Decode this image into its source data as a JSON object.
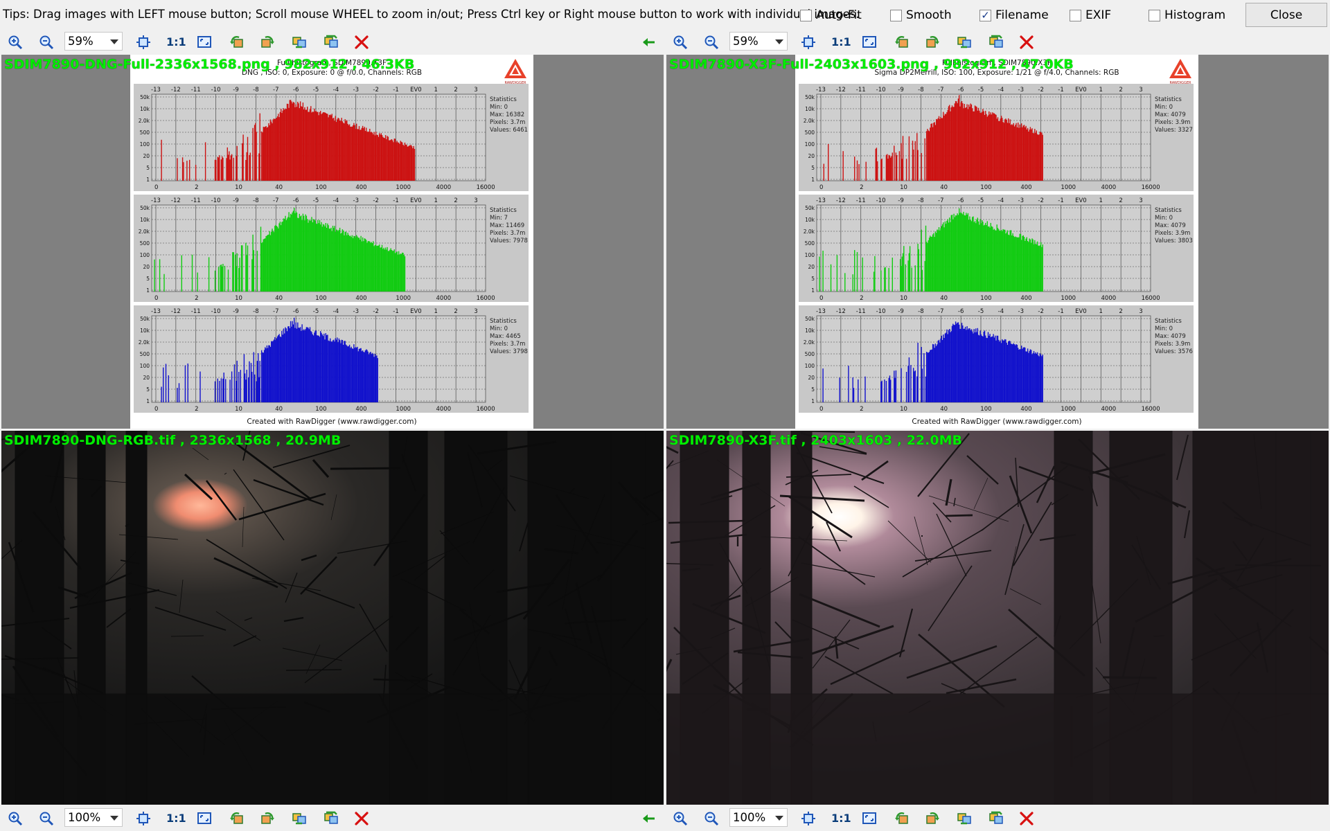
{
  "topbar": {
    "tips": "Tips: Drag images with LEFT mouse button; Scroll mouse WHEEL to zoom in/out; Press Ctrl key or Right mouse button to work with individual images.",
    "options": [
      {
        "label": "Auto-Fit",
        "checked": false
      },
      {
        "label": "Smooth",
        "checked": false
      },
      {
        "label": "Filename",
        "checked": true
      },
      {
        "label": "EXIF",
        "checked": false
      },
      {
        "label": "Histogram",
        "checked": false
      }
    ],
    "close_label": "Close"
  },
  "toolbars": {
    "top": {
      "zoom": "59%",
      "one_to_one": "1:1"
    },
    "bottom": {
      "zoom": "100%",
      "one_to_one": "1:1"
    }
  },
  "panes": {
    "top_left": {
      "label": "SDIM7890-DNG-Full-2336x1568.png , 982x912 , 46.3KB",
      "hist_title": "Full histogram, SDIM7890.X3F",
      "hist_sub": "DNG , ISO: 0, Exposure: 0 @ f/0.0, Channels: RGB",
      "stats": [
        [
          "Statistics",
          "Min: 0",
          "Max: 16382",
          "Pixels: 3.7m",
          "Values: 6461"
        ],
        [
          "Statistics",
          "Min: 7",
          "Max: 11469",
          "Pixels: 3.7m",
          "Values: 7978"
        ],
        [
          "Statistics",
          "Min: 0",
          "Max: 4465",
          "Pixels: 3.7m",
          "Values: 3798"
        ]
      ],
      "credit": "Created with RawDigger (www.rawdigger.com)"
    },
    "top_right": {
      "label": "SDIM7890-X3F-Full-2403x1603.png , 982x912 , 47.0KB",
      "hist_title": "Full histogram, SDIM7890.X3F",
      "hist_sub": "Sigma DP2Merrill, ISO: 100, Exposure: 1/21 @ f/4.0, Channels: RGB",
      "stats": [
        [
          "Statistics",
          "Min: 0",
          "Max: 4079",
          "Pixels: 3.9m",
          "Values: 3327"
        ],
        [
          "Statistics",
          "Min: 0",
          "Max: 4079",
          "Pixels: 3.9m",
          "Values: 3803"
        ],
        [
          "Statistics",
          "Min: 0",
          "Max: 4079",
          "Pixels: 3.9m",
          "Values: 3576"
        ]
      ],
      "credit": "Created with RawDigger (www.rawdigger.com)"
    },
    "bottom_left": {
      "label": "SDIM7890-DNG-RGB.tif , 2336x1568 , 20.9MB"
    },
    "bottom_right": {
      "label": "SDIM7890-X3F.tif , 2403x1603 , 22.0MB"
    }
  },
  "axis": {
    "ev": [
      "-13",
      "-12",
      "-11",
      "-10",
      "-9",
      "-8",
      "-7",
      "-6",
      "-5",
      "-4",
      "-3",
      "-2",
      "-1",
      "EV0",
      "1",
      "2",
      "3"
    ],
    "x": [
      "0",
      "2",
      "10",
      "40",
      "100",
      "400",
      "1000",
      "4000",
      "16000"
    ],
    "y": [
      "50k",
      "10k",
      "2.0k",
      "500",
      "100",
      "20",
      "5",
      "1"
    ],
    "logo_text": "RAWDIGGER"
  },
  "colors": {
    "red": "#cc1111",
    "green": "#11cc11",
    "blue": "#1111cc",
    "label": "#00ee00"
  }
}
